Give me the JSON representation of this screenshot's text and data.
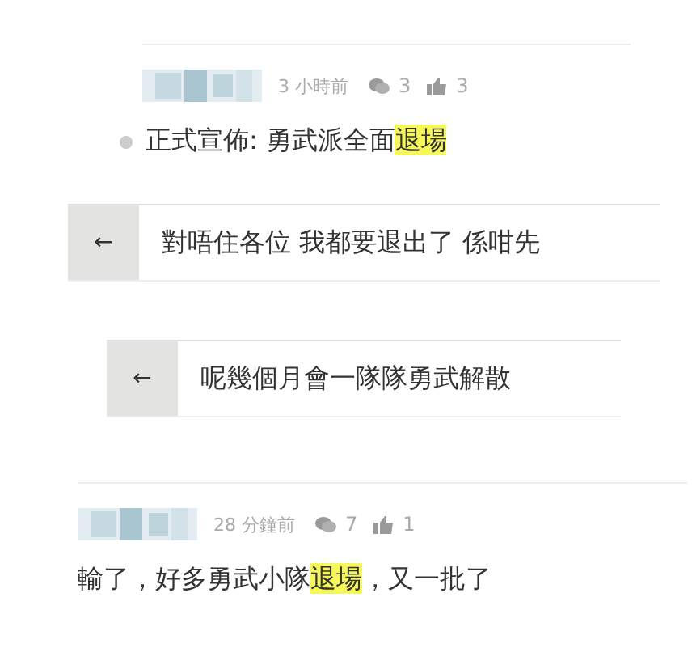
{
  "posts": [
    {
      "kind": "comment",
      "bullet": true,
      "time": "3 小時前",
      "replies": "3",
      "likes": "3",
      "text": [
        {
          "t": "正式宣佈: 勇武派全面",
          "highlighted": false
        },
        {
          "t": "退場",
          "highlighted": true
        }
      ]
    },
    {
      "kind": "quote",
      "arrow": "←",
      "text": "對唔住各位 我都要退出了 係咁先"
    },
    {
      "kind": "quote",
      "arrow": "←",
      "text": "呢幾個月會一隊隊勇武解散"
    },
    {
      "kind": "comment",
      "bullet": false,
      "time": "28 分鐘前",
      "replies": "7",
      "likes": "1",
      "text": [
        {
          "t": "輸了，好多勇武小隊",
          "highlighted": false
        },
        {
          "t": "退場",
          "highlighted": true
        },
        {
          "t": "，又一批了",
          "highlighted": false
        }
      ]
    }
  ]
}
